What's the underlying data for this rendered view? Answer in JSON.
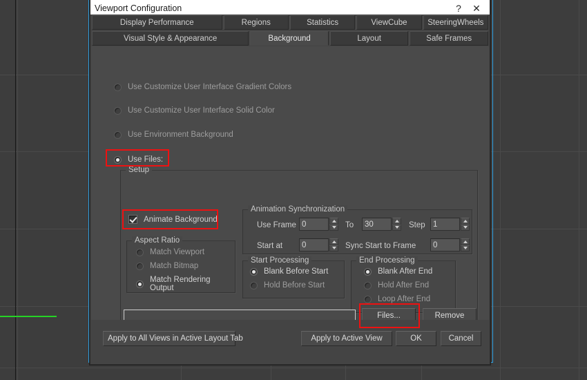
{
  "window": {
    "title": "Viewport Configuration",
    "help_button": "?",
    "close_button": "✕"
  },
  "tabs": {
    "row1": [
      {
        "label": "Display Performance",
        "active": false
      },
      {
        "label": "Regions",
        "active": false
      },
      {
        "label": "Statistics",
        "active": false
      },
      {
        "label": "ViewCube",
        "active": false
      },
      {
        "label": "SteeringWheels",
        "active": false
      }
    ],
    "row2": [
      {
        "label": "Visual Style & Appearance",
        "active": false
      },
      {
        "label": "Background",
        "active": true
      },
      {
        "label": "Layout",
        "active": false
      },
      {
        "label": "Safe Frames",
        "active": false
      }
    ]
  },
  "background_options": [
    {
      "label": "Use Customize User Interface Gradient Colors",
      "selected": false
    },
    {
      "label": "Use Customize User Interface Solid Color",
      "selected": false
    },
    {
      "label": "Use Environment Background",
      "selected": false
    },
    {
      "label": "Use Files:",
      "selected": true
    }
  ],
  "setup": {
    "title": "Setup",
    "animate_background": {
      "label": "Animate Background",
      "checked": true
    },
    "aspect_ratio": {
      "title": "Aspect Ratio",
      "options": [
        {
          "label": "Match Viewport",
          "selected": false
        },
        {
          "label": "Match Bitmap",
          "selected": false
        },
        {
          "label": "Match Rendering Output",
          "selected": true
        }
      ]
    },
    "animation_sync": {
      "title": "Animation Synchronization",
      "use_frame_label": "Use Frame",
      "use_frame_value": "0",
      "to_label": "To",
      "to_value": "30",
      "step_label": "Step",
      "step_value": "1",
      "start_at_label": "Start at",
      "start_at_value": "0",
      "sync_start_label": "Sync Start to Frame",
      "sync_start_value": "0"
    },
    "start_processing": {
      "title": "Start Processing",
      "options": [
        {
          "label": "Blank Before Start",
          "selected": true
        },
        {
          "label": "Hold Before Start",
          "selected": false
        }
      ]
    },
    "end_processing": {
      "title": "End Processing",
      "options": [
        {
          "label": "Blank After End",
          "selected": true
        },
        {
          "label": "Hold After End",
          "selected": false
        },
        {
          "label": "Loop After End",
          "selected": false
        }
      ]
    },
    "file_path": {
      "value": "",
      "placeholder": ""
    },
    "files_button": "Files...",
    "remove_button": "Remove"
  },
  "footer": {
    "apply_all_views": "Apply to All Views in Active Layout Tab",
    "apply_active_view": "Apply to Active View",
    "ok": "OK",
    "cancel": "Cancel"
  },
  "colors": {
    "dialog_bg": "#444444",
    "panel_bg": "#4a4a4a",
    "titlebar_bg": "#ffffff",
    "accent_highlight": "#ee1111",
    "selection_blue": "#2e9fe0",
    "green_object": "#25d425"
  }
}
